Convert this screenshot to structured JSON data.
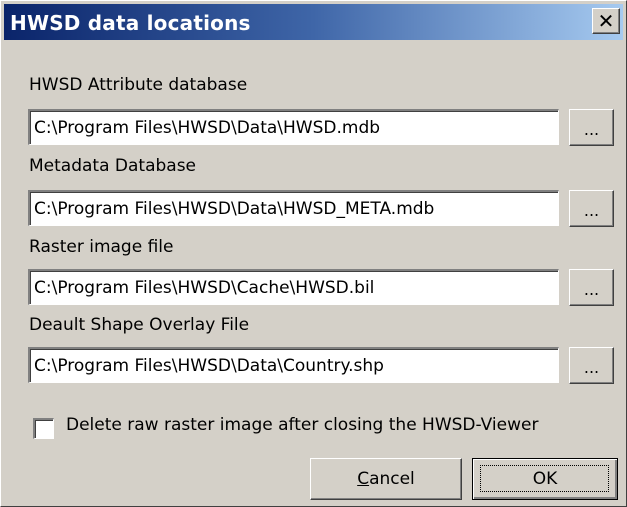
{
  "window": {
    "title": "HWSD data locations",
    "close_glyph": "✕"
  },
  "fields": [
    {
      "label": "HWSD Attribute database",
      "value": "C:\\Program Files\\HWSD\\Data\\HWSD.mdb",
      "browse_label": "..."
    },
    {
      "label": "Metadata Database",
      "value": "C:\\Program Files\\HWSD\\Data\\HWSD_META.mdb",
      "browse_label": "..."
    },
    {
      "label": "Raster image file",
      "value": "C:\\Program Files\\HWSD\\Cache\\HWSD.bil",
      "browse_label": "..."
    },
    {
      "label": "Deault Shape Overlay File",
      "value": "C:\\Program Files\\HWSD\\Data\\Country.shp",
      "browse_label": "..."
    }
  ],
  "checkbox": {
    "label": "Delete raw raster image after closing the HWSD-Viewer",
    "checked": false
  },
  "buttons": {
    "cancel_mnemonic": "C",
    "cancel_rest": "ancel",
    "ok_label": "OK"
  },
  "colors": {
    "face": "#d4d0c8",
    "title_start": "#0a246a",
    "title_end": "#a6caf0"
  }
}
